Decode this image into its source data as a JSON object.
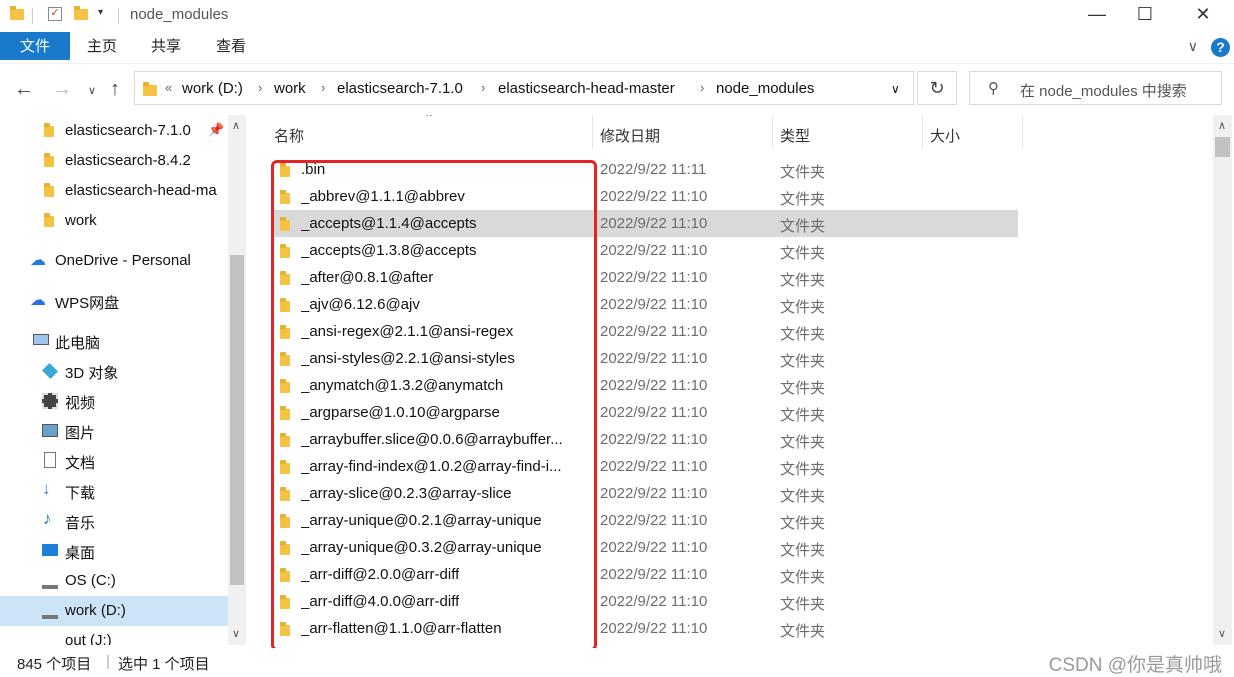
{
  "window": {
    "title": "node_modules",
    "minimize": "—",
    "maximize": "☐",
    "close": "✕"
  },
  "ribbon": {
    "tabs": [
      "文件",
      "主页",
      "共享",
      "查看"
    ],
    "help": "?",
    "collapse": "∨"
  },
  "address": {
    "prefix": "«",
    "crumbs": [
      "work (D:)",
      "work",
      "elasticsearch-7.1.0",
      "elasticsearch-head-master",
      "node_modules"
    ],
    "dropdown": "∨",
    "refresh": "↻"
  },
  "search": {
    "placeholder": "在 node_modules 中搜索"
  },
  "sidebar": {
    "items": [
      {
        "label": "elasticsearch-7.1.0",
        "icon": "folder-icon",
        "pinned": true
      },
      {
        "label": "elasticsearch-8.4.2",
        "icon": "folder-icon"
      },
      {
        "label": "elasticsearch-head-ma",
        "icon": "folder-icon"
      },
      {
        "label": "work",
        "icon": "folder-icon"
      },
      {
        "label": "OneDrive - Personal",
        "icon": "cloud-icon"
      },
      {
        "label": "WPS网盘",
        "icon": "wps-cloud-icon"
      },
      {
        "label": "此电脑",
        "icon": "computer-icon"
      },
      {
        "label": "3D 对象",
        "icon": "cube-icon"
      },
      {
        "label": "视频",
        "icon": "video-icon"
      },
      {
        "label": "图片",
        "icon": "picture-icon"
      },
      {
        "label": "文档",
        "icon": "document-icon"
      },
      {
        "label": "下载",
        "icon": "download-icon"
      },
      {
        "label": "音乐",
        "icon": "music-icon"
      },
      {
        "label": "桌面",
        "icon": "desktop-icon"
      },
      {
        "label": "OS (C:)",
        "icon": "drive-icon"
      },
      {
        "label": "work (D:)",
        "icon": "drive-icon",
        "selected": true
      },
      {
        "label": "out (J:)",
        "icon": "drive-icon"
      }
    ]
  },
  "columns": {
    "name": "名称",
    "modified": "修改日期",
    "type": "类型",
    "size": "大小"
  },
  "files": [
    {
      "name": ".bin",
      "modified": "2022/9/22 11:11",
      "type": "文件夹"
    },
    {
      "name": "_abbrev@1.1.1@abbrev",
      "modified": "2022/9/22 11:10",
      "type": "文件夹"
    },
    {
      "name": "_accepts@1.1.4@accepts",
      "modified": "2022/9/22 11:10",
      "type": "文件夹",
      "selected": true
    },
    {
      "name": "_accepts@1.3.8@accepts",
      "modified": "2022/9/22 11:10",
      "type": "文件夹"
    },
    {
      "name": "_after@0.8.1@after",
      "modified": "2022/9/22 11:10",
      "type": "文件夹"
    },
    {
      "name": "_ajv@6.12.6@ajv",
      "modified": "2022/9/22 11:10",
      "type": "文件夹"
    },
    {
      "name": "_ansi-regex@2.1.1@ansi-regex",
      "modified": "2022/9/22 11:10",
      "type": "文件夹"
    },
    {
      "name": "_ansi-styles@2.2.1@ansi-styles",
      "modified": "2022/9/22 11:10",
      "type": "文件夹"
    },
    {
      "name": "_anymatch@1.3.2@anymatch",
      "modified": "2022/9/22 11:10",
      "type": "文件夹"
    },
    {
      "name": "_argparse@1.0.10@argparse",
      "modified": "2022/9/22 11:10",
      "type": "文件夹"
    },
    {
      "name": "_arraybuffer.slice@0.0.6@arraybuffer...",
      "modified": "2022/9/22 11:10",
      "type": "文件夹"
    },
    {
      "name": "_array-find-index@1.0.2@array-find-i...",
      "modified": "2022/9/22 11:10",
      "type": "文件夹"
    },
    {
      "name": "_array-slice@0.2.3@array-slice",
      "modified": "2022/9/22 11:10",
      "type": "文件夹"
    },
    {
      "name": "_array-unique@0.2.1@array-unique",
      "modified": "2022/9/22 11:10",
      "type": "文件夹"
    },
    {
      "name": "_array-unique@0.3.2@array-unique",
      "modified": "2022/9/22 11:10",
      "type": "文件夹"
    },
    {
      "name": "_arr-diff@2.0.0@arr-diff",
      "modified": "2022/9/22 11:10",
      "type": "文件夹"
    },
    {
      "name": "_arr-diff@4.0.0@arr-diff",
      "modified": "2022/9/22 11:10",
      "type": "文件夹"
    },
    {
      "name": "_arr-flatten@1.1.0@arr-flatten",
      "modified": "2022/9/22 11:10",
      "type": "文件夹"
    }
  ],
  "status": {
    "count": "845 个项目",
    "selected": "选中 1 个项目"
  },
  "watermark": "CSDN @你是真帅哦",
  "colors": {
    "accent": "#1979ca",
    "highlight_box": "#e62323",
    "selected_row": "#d9d9d9",
    "selected_nav": "#cce4f7"
  }
}
